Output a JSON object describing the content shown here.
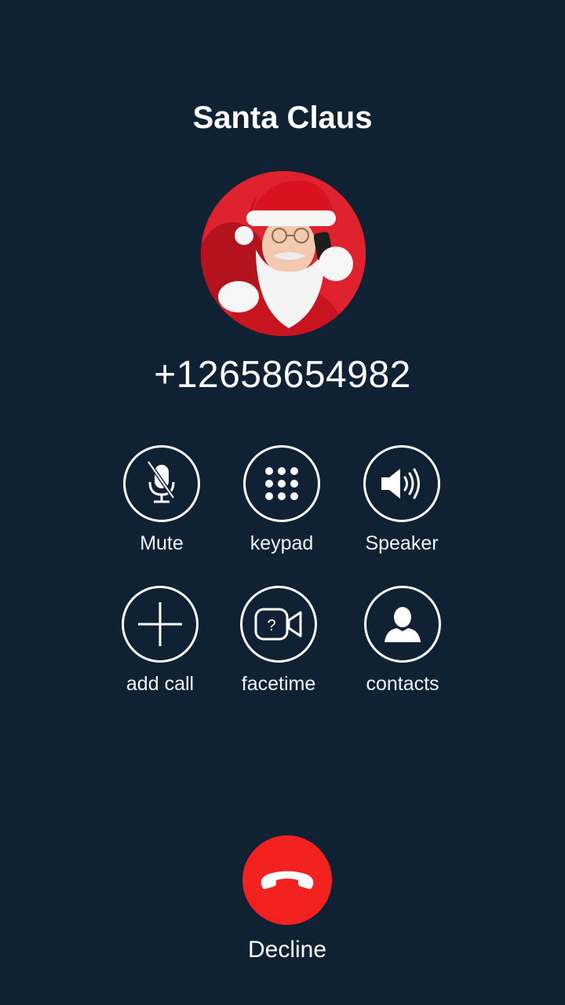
{
  "caller": {
    "name": "Santa Claus",
    "number": "+12658654982"
  },
  "controls": [
    {
      "label": "Mute",
      "icon": "mic-muted-icon"
    },
    {
      "label": "keypad",
      "icon": "keypad-icon"
    },
    {
      "label": "Speaker",
      "icon": "speaker-icon"
    },
    {
      "label": "add call",
      "icon": "plus-icon"
    },
    {
      "label": "facetime",
      "icon": "video-question-icon"
    },
    {
      "label": "contacts",
      "icon": "person-icon"
    }
  ],
  "decline": {
    "label": "Decline",
    "color": "#f4221f",
    "icon": "phone-hangup-icon"
  },
  "colors": {
    "background": "#0f2132",
    "text": "#ffffff"
  }
}
